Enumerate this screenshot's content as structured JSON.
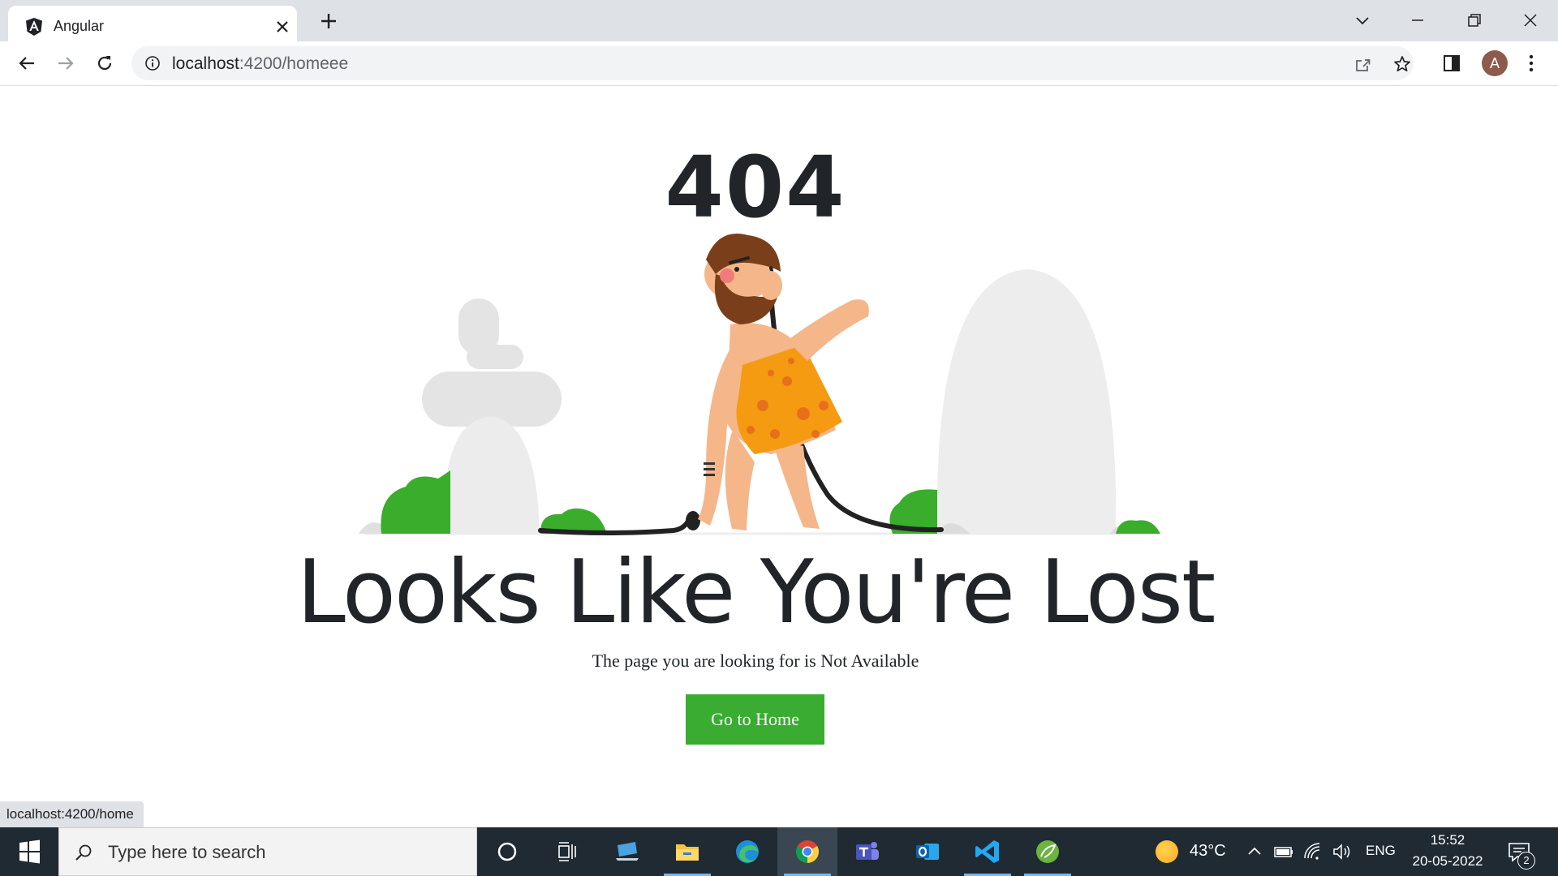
{
  "browser": {
    "tab_title": "Angular",
    "url_host": "localhost",
    "url_path": ":4200/homeee",
    "avatar_letter": "A",
    "status_url": "localhost:4200/home"
  },
  "page": {
    "code": "404",
    "headline": "Looks Like You're Lost",
    "subtext": "The page you are looking for is Not Available",
    "button_label": "Go to Home",
    "button_color": "#39ac31"
  },
  "taskbar": {
    "search_placeholder": "Type here to search",
    "apps": [
      "cortana-icon",
      "task-view-icon",
      "network-pc-icon",
      "file-explorer-icon",
      "edge-icon",
      "chrome-icon",
      "teams-icon",
      "outlook-icon",
      "vscode-icon",
      "spring-icon"
    ],
    "weather_temp": "43°C",
    "language": "ENG",
    "time": "15:52",
    "date": "20-05-2022",
    "notification_count": "2"
  }
}
